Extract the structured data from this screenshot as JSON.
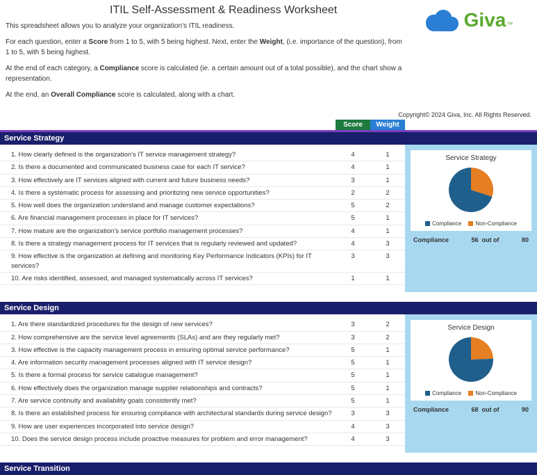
{
  "title": "ITIL Self-Assessment & Readiness Worksheet",
  "intro1": "This spreadsheet allows you to analyze your organization's ITIL readiness.",
  "intro2a": "For each question, enter a ",
  "intro2b": "Score",
  "intro2c": " from 1 to 5, with 5 being highest.  Next, enter the ",
  "intro2d": "Weight",
  "intro2e": ", (i.e. importance of the question), from 1 to 5, with 5 being highest.",
  "intro3a": "At the end of each category, a ",
  "intro3b": "Compliance",
  "intro3c": " score is calculated (ie. a certain amount out of a total possible), and the chart show a representation.",
  "intro4a": "At the end, an ",
  "intro4b": "Overall Compliance",
  "intro4c": " score is calculated, along with a chart.",
  "logo_text": "Giva",
  "copyright": "Copyright© 2024 Giva, Inc. All Rights Reserved.",
  "col_score": "Score",
  "col_weight": "Weight",
  "legend_comp": "Compliance",
  "legend_non": "Non-Compliance",
  "comp_word": "Compliance",
  "outof_word": "out of",
  "categories": [
    {
      "name": "Service Strategy",
      "chart_title": "Service Strategy",
      "comp_score": 56,
      "comp_total": 80,
      "questions": [
        {
          "n": "1.",
          "t": "How clearly defined is the organization's IT service management strategy?",
          "s": 4,
          "w": 1
        },
        {
          "n": "2.",
          "t": "Is there a documented and communicated business case for each IT service?",
          "s": 4,
          "w": 1
        },
        {
          "n": "3.",
          "t": "How effectively are IT services aligned with current and future business needs?",
          "s": 3,
          "w": 1
        },
        {
          "n": "4.",
          "t": "Is there a systematic process for assessing and prioritizing new service opportunities?",
          "s": 2,
          "w": 2
        },
        {
          "n": "5.",
          "t": "How well does the organization understand and manage customer expectations?",
          "s": 5,
          "w": 2
        },
        {
          "n": "6.",
          "t": "Are financial management processes in place for IT services?",
          "s": 5,
          "w": 1
        },
        {
          "n": "7.",
          "t": "How mature are the organization's service portfolio management processes?",
          "s": 4,
          "w": 1
        },
        {
          "n": "8.",
          "t": "Is there a strategy management process for IT services that is regularly reviewed and updated?",
          "s": 4,
          "w": 3
        },
        {
          "n": "9.",
          "t": "How effective is the organization at defining and monitoring Key Performance Indicators (KPIs) for IT services?",
          "s": 3,
          "w": 3
        },
        {
          "n": "10.",
          "t": "Are risks identified, assessed, and managed systematically across IT services?",
          "s": 1,
          "w": 1
        }
      ]
    },
    {
      "name": "Service Design",
      "chart_title": "Service Design",
      "comp_score": 68,
      "comp_total": 90,
      "questions": [
        {
          "n": "1.",
          "t": "Are there standardized procedures for the design of new services?",
          "s": 3,
          "w": 2
        },
        {
          "n": "2.",
          "t": "How comprehensive are the service level agreements (SLAs) and are they regularly met?",
          "s": 3,
          "w": 2
        },
        {
          "n": "3.",
          "t": "How effective is the capacity management process in ensuring optimal service performance?",
          "s": 5,
          "w": 1
        },
        {
          "n": "4.",
          "t": "Are information security management processes aligned with IT service design?",
          "s": 5,
          "w": 1
        },
        {
          "n": "5.",
          "t": "Is there a formal process for service catalogue management?",
          "s": 5,
          "w": 1
        },
        {
          "n": "6.",
          "t": "How effectively does the organization manage supplier relationships and contracts?",
          "s": 5,
          "w": 1
        },
        {
          "n": "7.",
          "t": "Are service continuity and availability goals consistently met?",
          "s": 5,
          "w": 1
        },
        {
          "n": "8.",
          "t": "Is there an established process for ensuring compliance with architectural standards during service design?",
          "s": 3,
          "w": 3
        },
        {
          "n": "9.",
          "t": "How are user experiences incorporated into service design?",
          "s": 4,
          "w": 3
        },
        {
          "n": "10.",
          "t": "Does the service design process include proactive measures for problem and error management?",
          "s": 4,
          "w": 3
        }
      ]
    },
    {
      "name": "Service Transition",
      "questions": []
    }
  ],
  "chart_data": [
    {
      "type": "pie",
      "title": "Service Strategy",
      "series": [
        {
          "name": "Compliance",
          "value": 56,
          "color": "#1f5f8b"
        },
        {
          "name": "Non-Compliance",
          "value": 24,
          "color": "#e67e22"
        }
      ]
    },
    {
      "type": "pie",
      "title": "Service Design",
      "series": [
        {
          "name": "Compliance",
          "value": 68,
          "color": "#1f5f8b"
        },
        {
          "name": "Non-Compliance",
          "value": 22,
          "color": "#e67e22"
        }
      ]
    }
  ]
}
